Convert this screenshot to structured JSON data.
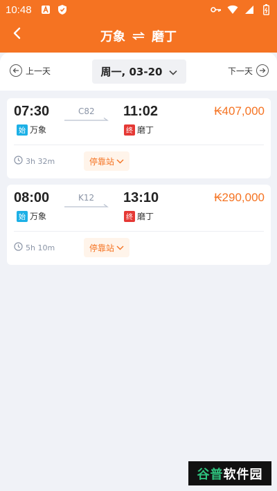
{
  "status_bar": {
    "time": "10:48",
    "left_icons": [
      "a-icon",
      "shield-icon"
    ],
    "right_icons": [
      "key-icon",
      "wifi-icon",
      "signal-icon",
      "battery-icon"
    ]
  },
  "header": {
    "from": "万象",
    "to": "磨丁",
    "swap_icon": "swap-icon",
    "back_icon": "chevron-left-icon"
  },
  "date_bar": {
    "prev_label": "上一天",
    "next_label": "下一天",
    "date_value": "周一, 03-20"
  },
  "trips": [
    {
      "depart": "07:30",
      "arrive": "11:02",
      "train": "C82",
      "price": "₭407,000",
      "from_badge": "始",
      "from": "万象",
      "to_badge": "终",
      "to": "磨丁",
      "duration": "3h 32m",
      "stops_label": "停靠站"
    },
    {
      "depart": "08:00",
      "arrive": "13:10",
      "train": "K12",
      "price": "₭290,000",
      "from_badge": "始",
      "from": "万象",
      "to_badge": "终",
      "to": "磨丁",
      "duration": "5h 10m",
      "stops_label": "停靠站"
    }
  ],
  "watermark": {
    "part1": "谷普",
    "part2": "软件园"
  },
  "colors": {
    "accent": "#f57322",
    "start_badge": "#1cb0e6",
    "end_badge": "#e53935",
    "background": "#f0f2f7"
  }
}
